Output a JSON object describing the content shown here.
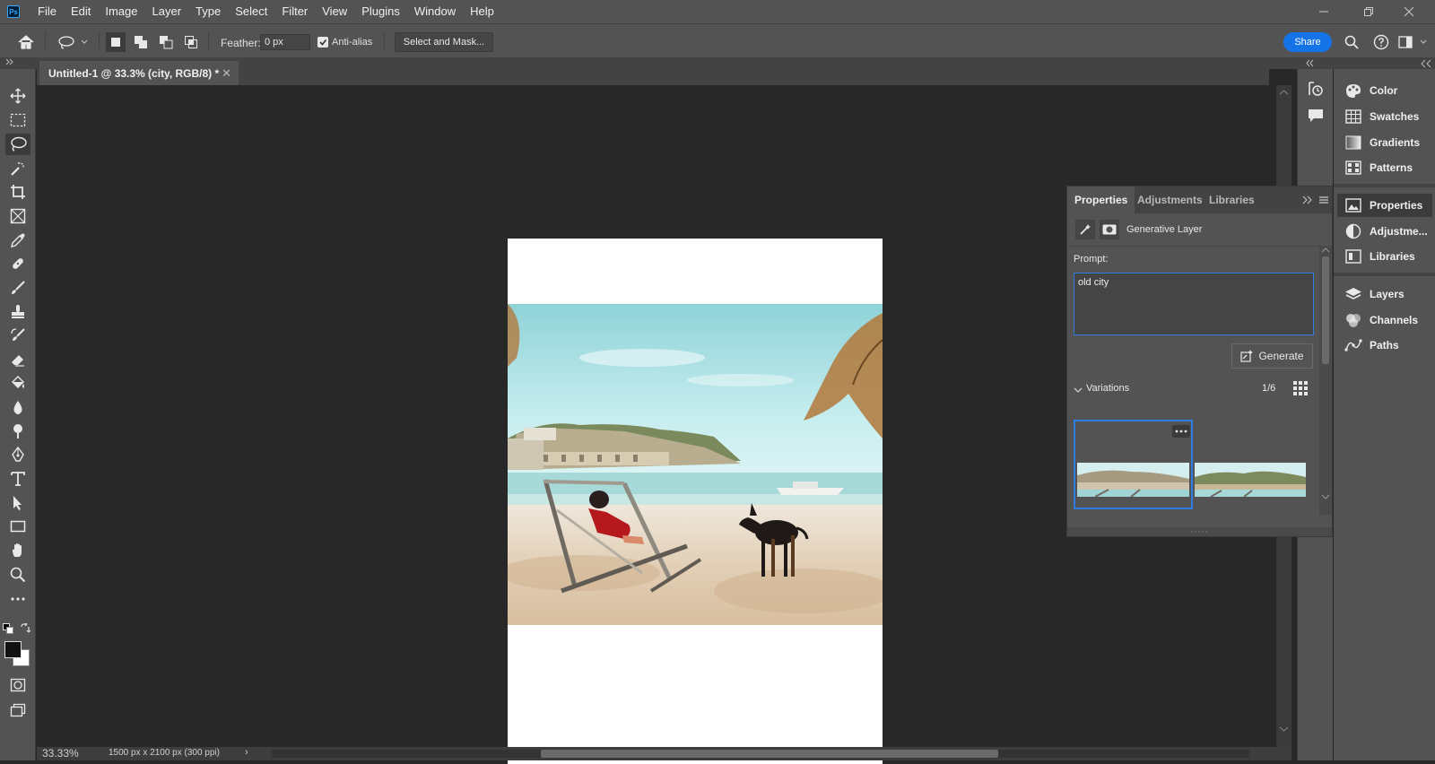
{
  "menubar": {
    "app_icon_text": "Ps",
    "items": [
      "File",
      "Edit",
      "Image",
      "Layer",
      "Type",
      "Select",
      "Filter",
      "View",
      "Plugins",
      "Window",
      "Help"
    ]
  },
  "options": {
    "feather_label": "Feather:",
    "feather_value": "0 px",
    "antialias_label": "Anti-alias",
    "antialias_checked": true,
    "select_mask_label": "Select and Mask...",
    "share_label": "Share"
  },
  "document": {
    "tab_title": "Untitled-1 @ 33.3% (city, RGB/8) *",
    "close_glyph": "✕"
  },
  "status": {
    "zoom": "33.33%",
    "doc_size": "1500 px x 2100 px (300 ppi)",
    "arrow": "›"
  },
  "dock": {
    "items": [
      "Color",
      "Swatches",
      "Gradients",
      "Patterns",
      "Properties",
      "Adjustme...",
      "Libraries",
      "Layers",
      "Channels",
      "Paths"
    ]
  },
  "properties": {
    "tabs": [
      "Properties",
      "Adjustments",
      "Libraries"
    ],
    "layer_type": "Generative Layer",
    "prompt_label": "Prompt:",
    "prompt_value": "old city",
    "generate_label": "Generate",
    "variations_label": "Variations",
    "variations_count": "1/6"
  },
  "colors": {
    "accent": "#1473e6",
    "selection_blue": "#2f7de0",
    "panel": "#535353",
    "canvas_bg": "#282828"
  }
}
